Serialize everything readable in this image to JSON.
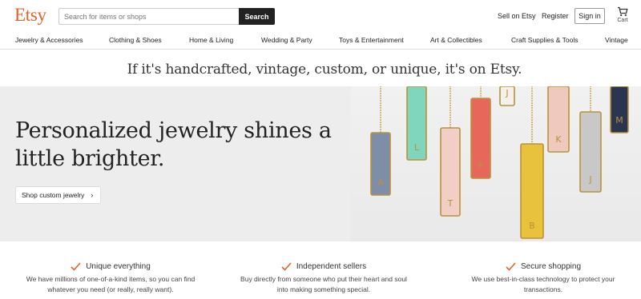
{
  "header": {
    "logo": "Etsy",
    "search_placeholder": "Search for items or shops",
    "search_button": "Search",
    "sell_link": "Sell on Etsy",
    "register_link": "Register",
    "signin_button": "Sign in",
    "cart_label": "Cart"
  },
  "nav": {
    "items": [
      "Jewelry & Accessories",
      "Clothing & Shoes",
      "Home & Living",
      "Wedding & Party",
      "Toys & Entertainment",
      "Art & Collectibles",
      "Craft Supplies & Tools",
      "Vintage"
    ]
  },
  "tagline": "If it's handcrafted, vintage, custom, or unique, it's on Etsy.",
  "hero": {
    "title": "Personalized jewelry shines a little brighter.",
    "button": "Shop custom jewelry",
    "pendants": [
      {
        "letter": "A",
        "color": "#7f8ea8"
      },
      {
        "letter": "L",
        "color": "#7fd6bd"
      },
      {
        "letter": "T",
        "color": "#f2cfc4"
      },
      {
        "letter": "P",
        "color": "#e8675b"
      },
      {
        "letter": "J",
        "color": "#f5f0ea"
      },
      {
        "letter": "B",
        "color": "#e8c23a"
      },
      {
        "letter": "K",
        "color": "#efc9bd"
      },
      {
        "letter": "J",
        "color": "#c8c8c8"
      },
      {
        "letter": "M",
        "color": "#2a3550"
      }
    ]
  },
  "value_props": [
    {
      "title": "Unique everything",
      "description": "We have millions of one-of-a-kind items, so you can find whatever you need (or really, really want)."
    },
    {
      "title": "Independent sellers",
      "description": "Buy directly from someone who put their heart and soul into making something special."
    },
    {
      "title": "Secure shopping",
      "description": "We use best-in-class technology to protect your transactions."
    }
  ],
  "colors": {
    "brand": "#e5612a",
    "check": "#e5612a",
    "search_button": "#222222",
    "hero_bg": "#ededed"
  }
}
